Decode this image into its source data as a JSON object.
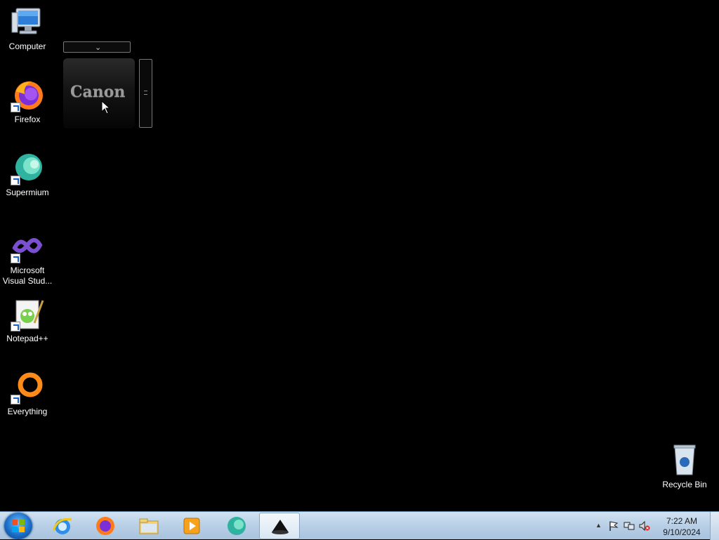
{
  "desktop": {
    "icons": [
      {
        "label": "Computer"
      },
      {
        "label": "Firefox"
      },
      {
        "label": "Supermium"
      },
      {
        "label": "Microsoft Visual Stud..."
      },
      {
        "label": "Notepad++"
      },
      {
        "label": "Everything"
      },
      {
        "label": "Recycle Bin"
      }
    ]
  },
  "gadget": {
    "brand_text": "Canon",
    "dropdown_icon": "chevron-down-icon"
  },
  "taskbar": {
    "pinned": [
      "internet-explorer",
      "firefox",
      "file-explorer",
      "media-player",
      "supermium",
      "active-app"
    ],
    "clock": {
      "time": "7:22 AM",
      "date": "9/10/2024"
    },
    "tray_icons": [
      "show-hidden-icons",
      "action-center-flag",
      "network",
      "volume-muted"
    ]
  },
  "colors": {
    "desktop_bg": "#000000",
    "taskbar_bg": "#b8cfe6"
  }
}
